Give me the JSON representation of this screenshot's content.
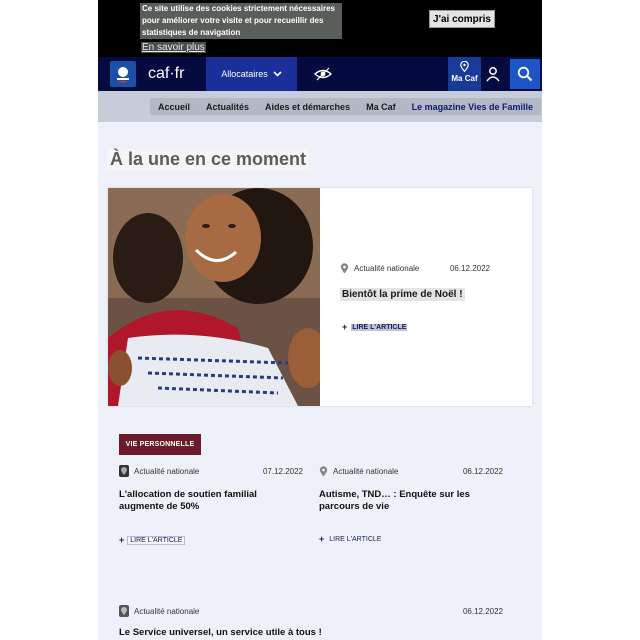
{
  "cookie": {
    "text": "Ce site utilise des cookies strictement nécessaires pour améliorer votre visite et pour recueillir des statistiques de navigation",
    "more_link": "En savoir plus",
    "accept_button": "J'ai compris"
  },
  "header": {
    "brand": "caf·fr",
    "dropdown_label": "Allocataires",
    "macaf_label": "Ma Caf",
    "icons": [
      "republique-logo-icon",
      "eye-icon",
      "location-pin-icon",
      "user-icon",
      "search-icon",
      "chevron-down-icon"
    ]
  },
  "subnav": {
    "items": [
      "Accueil",
      "Actualités",
      "Aides et démarches",
      "Ma Caf",
      "Le magazine Vies de Famille"
    ]
  },
  "main": {
    "headline": "À la une en ce moment",
    "featured": {
      "location": "Actualité nationale",
      "date": "06.12.2022",
      "title": "Bientôt la prime de Noël !",
      "read_label": "LIRE L'ARTICLE"
    },
    "category_tag": "VIE PERSONNELLE",
    "articles": [
      {
        "location": "Actualité nationale",
        "date": "07.12.2022",
        "title": "L'allocation de soutien familial augmente de 50%",
        "read_label": "LIRE L'ARTICLE"
      },
      {
        "location": "Actualité nationale",
        "date": "06.12.2022",
        "title": "Autisme, TND… : Enquête sur les parcours de vie",
        "read_label": "LIRE L'ARTICLE"
      },
      {
        "location": "Actualité nationale",
        "date": "06.12.2022",
        "title": "Le Service universel, un service utile à tous !"
      }
    ]
  },
  "colors": {
    "nav_bg": "#050a40",
    "dropdown_bg": "#1a2f9a",
    "search_bg": "#1e55c6",
    "tag_bg": "#6b1b2b",
    "page_bg": "#eef1f9"
  }
}
